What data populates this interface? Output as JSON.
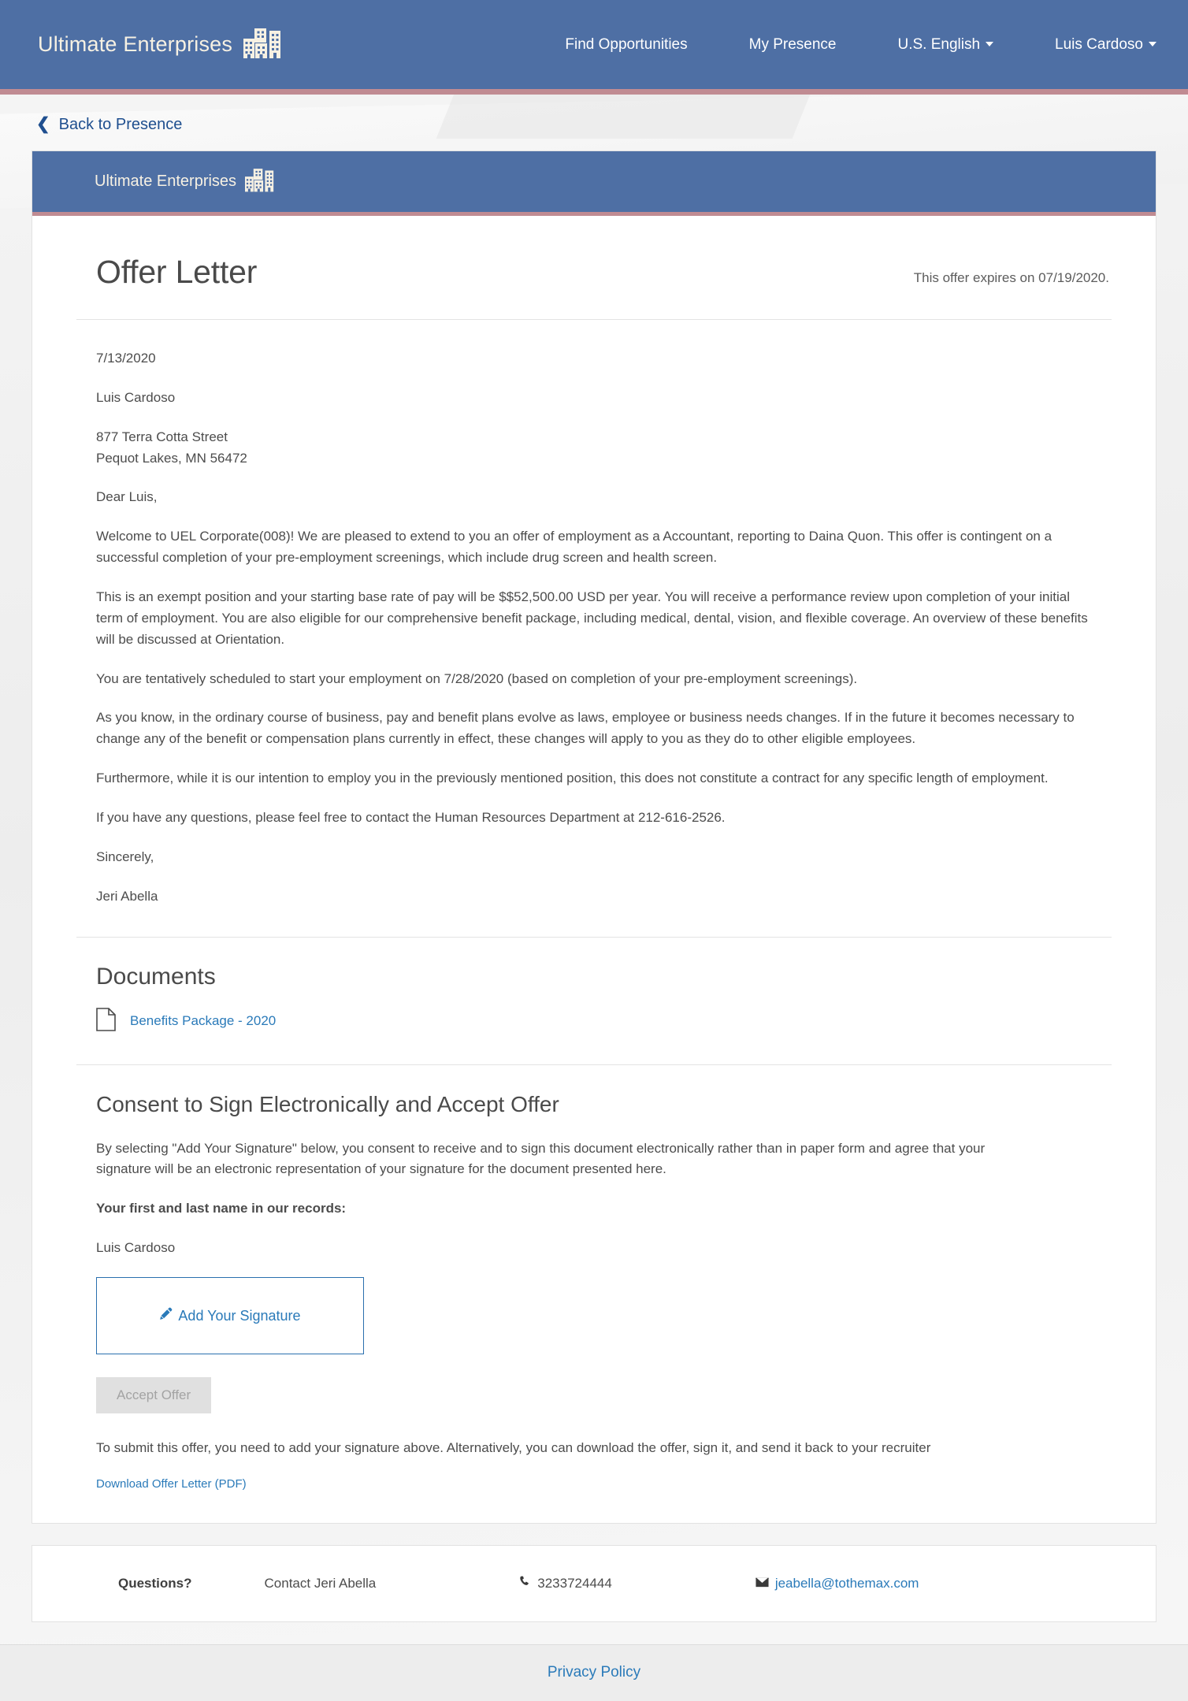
{
  "header": {
    "brand": "Ultimate Enterprises",
    "brand_icon": "city-buildings-icon",
    "nav": [
      {
        "label": "Find Opportunities",
        "caret": false
      },
      {
        "label": "My Presence",
        "caret": false
      },
      {
        "label": "U.S. English",
        "caret": true
      },
      {
        "label": "Luis Cardoso",
        "caret": true
      }
    ],
    "accent_color": "#c08b92",
    "bar_color": "#4e6fa4"
  },
  "back_link": {
    "label": "Back to Presence",
    "icon": "chevron-left-icon"
  },
  "card_header": {
    "brand": "Ultimate Enterprises",
    "brand_icon": "city-buildings-icon"
  },
  "offer": {
    "title": "Offer Letter",
    "expiry": "This offer expires on 07/19/2020.",
    "date": "7/13/2020",
    "recipient_name": "Luis Cardoso",
    "address": "877 Terra Cotta Street\nPequot Lakes, MN 56472",
    "salutation": "Dear Luis,",
    "paragraphs": [
      "Welcome to UEL Corporate(008)! We are pleased to extend to you an offer of employment as a Accountant, reporting to Daina Quon. This offer is contingent on a successful completion of your pre-employment screenings, which include drug screen and health screen.",
      "This is an exempt position and your starting base rate of pay will be $$52,500.00 USD per year. You will receive a performance review upon completion of your initial term of employment. You are also eligible for our comprehensive benefit package, including medical, dental, vision, and flexible coverage. An overview of these benefits will be discussed at Orientation.",
      "You are tentatively scheduled to start your employment on 7/28/2020 (based on completion of your pre-employment screenings).",
      "As you know, in the ordinary course of business, pay and benefit plans evolve as laws, employee or business needs changes. If in the future it becomes necessary to change any of the benefit or compensation plans currently in effect, these changes will apply to you as they do to other eligible employees.",
      "Furthermore, while it is our intention to employ you in the previously mentioned position, this does not constitute a contract for any specific length of employment.",
      "If you have any questions, please feel free to contact the Human Resources Department at 212-616-2526."
    ],
    "closing": "Sincerely,",
    "signer": "Jeri Abella"
  },
  "documents": {
    "heading": "Documents",
    "items": [
      {
        "label": "Benefits Package - 2020",
        "icon": "file-icon"
      }
    ]
  },
  "consent": {
    "heading": "Consent to Sign Electronically and Accept Offer",
    "body": "By selecting \"Add Your Signature\" below, you consent to receive and to sign this document electronically rather than in paper form and agree that your signature will be an electronic representation of your signature for the document presented here.",
    "records_label": "Your first and last name in our records:",
    "records_name": "Luis Cardoso",
    "signature_button": "Add Your Signature",
    "signature_icon": "pencil-icon",
    "accept_button": "Accept Offer",
    "accept_disabled": true,
    "submit_note": "To submit this offer, you need to add your signature above. Alternatively, you can download the offer, sign it, and send it back to your recruiter",
    "download_link": "Download Offer Letter (PDF)"
  },
  "contact": {
    "questions_label": "Questions?",
    "contact_name": "Contact Jeri Abella",
    "phone": "3233724444",
    "phone_icon": "phone-icon",
    "email": "jeabella@tothemax.com",
    "email_icon": "envelope-icon"
  },
  "footer": {
    "privacy_policy": "Privacy Policy"
  }
}
